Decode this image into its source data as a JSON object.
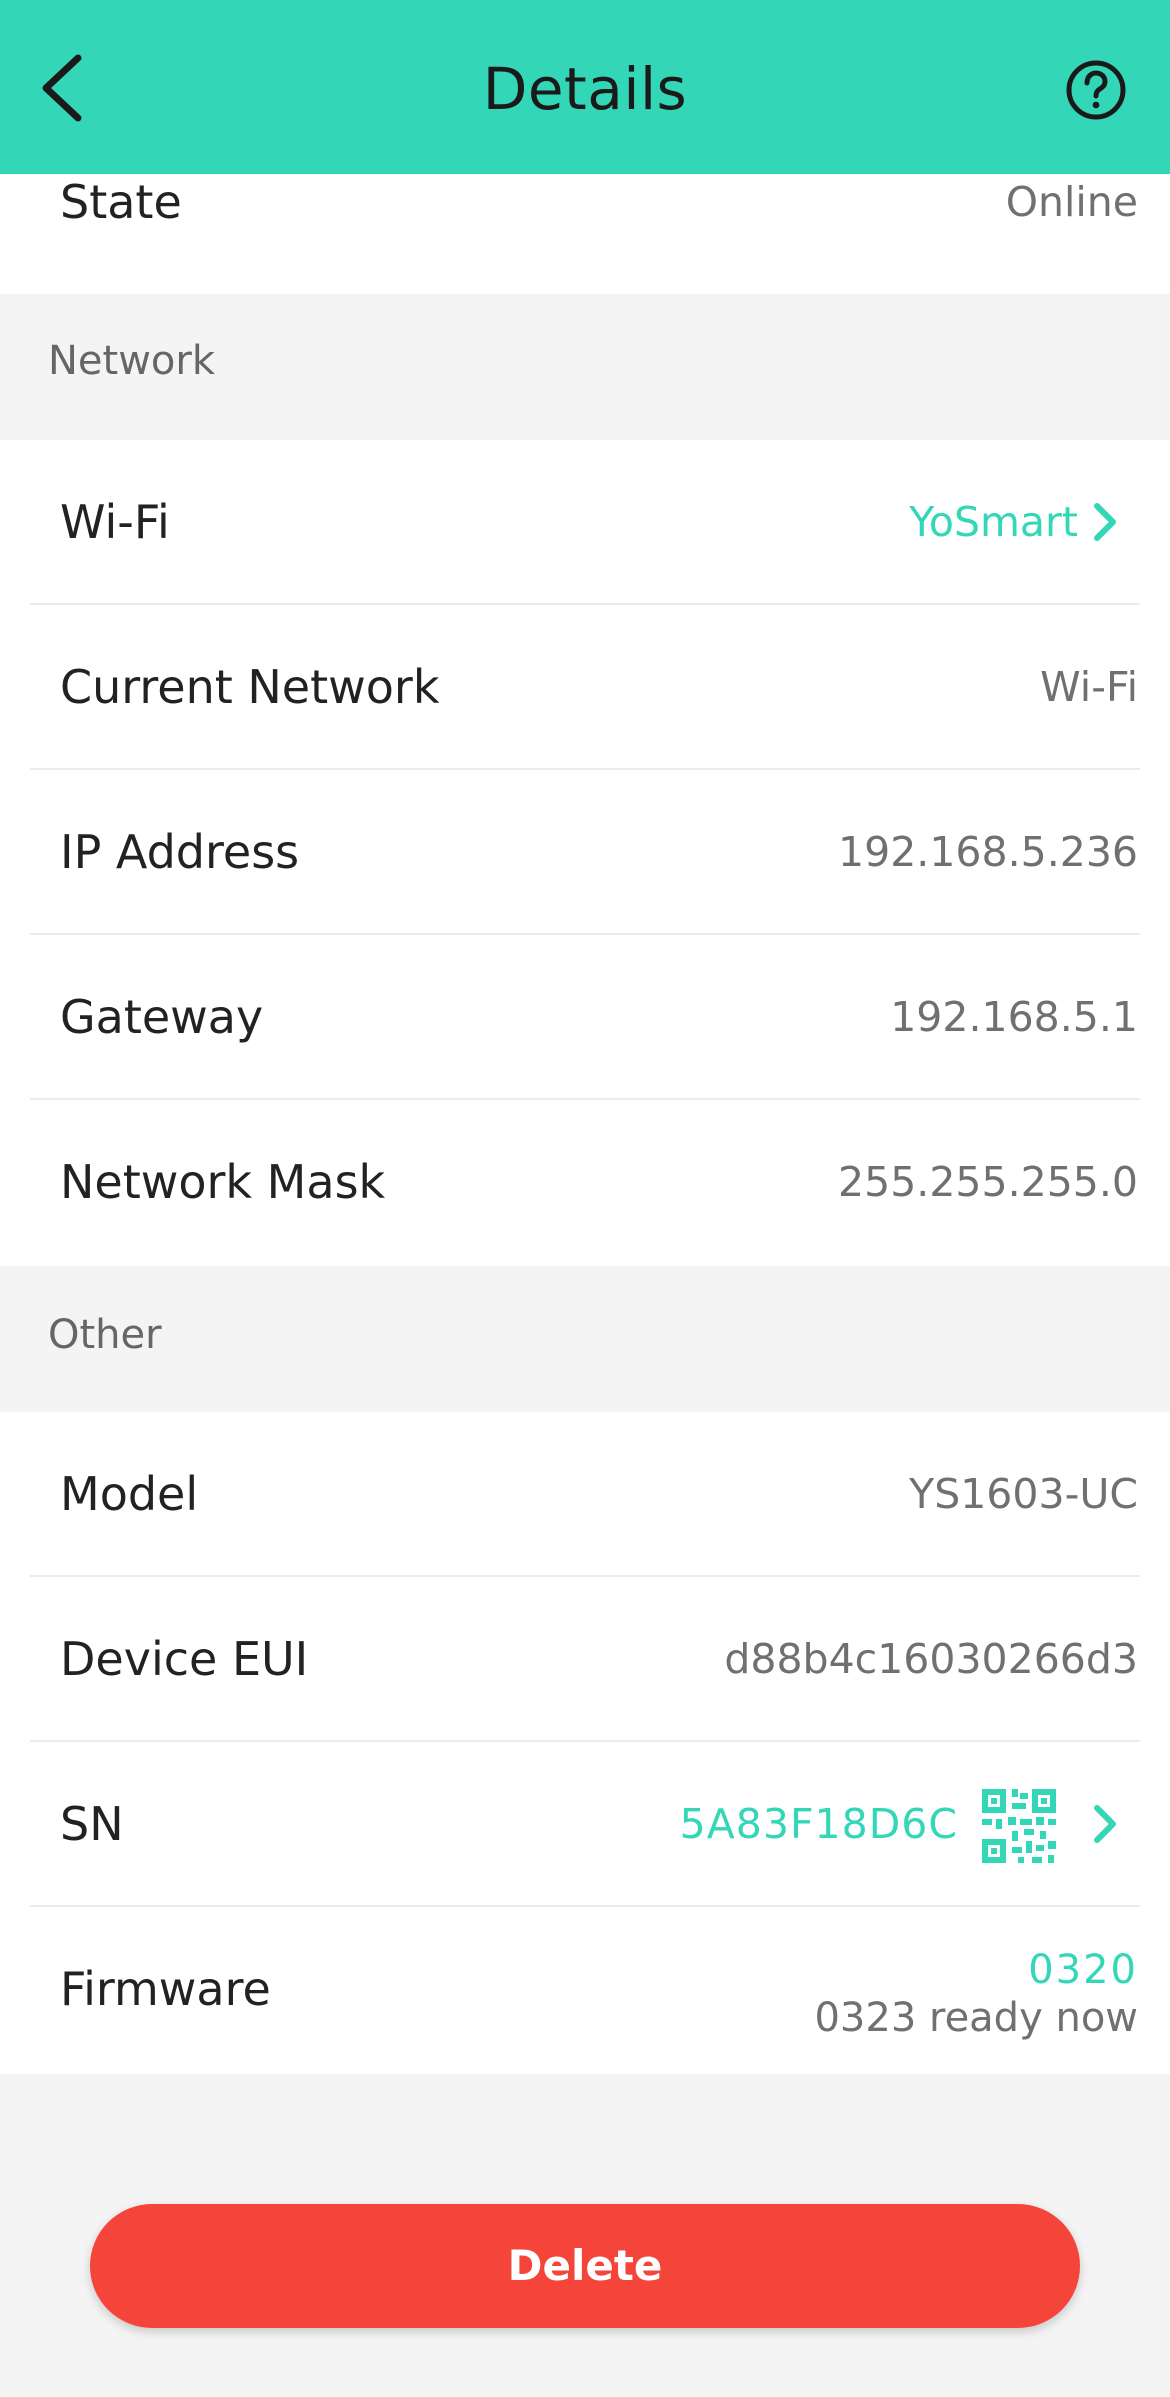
{
  "header": {
    "title": "Details",
    "back_icon": "chevron-left-icon",
    "help_icon": "question-circle-icon"
  },
  "state": {
    "label": "State",
    "value": "Online"
  },
  "network": {
    "section_title": "Network",
    "wifi": {
      "label": "Wi-Fi",
      "value": "YoSmart"
    },
    "current_network": {
      "label": "Current Network",
      "value": "Wi-Fi"
    },
    "ip_address": {
      "label": "IP Address",
      "value": "192.168.5.236"
    },
    "gateway": {
      "label": "Gateway",
      "value": "192.168.5.1"
    },
    "network_mask": {
      "label": "Network Mask",
      "value": "255.255.255.0"
    }
  },
  "other": {
    "section_title": "Other",
    "model": {
      "label": "Model",
      "value": "YS1603-UC"
    },
    "device_eui": {
      "label": "Device EUI",
      "value": "d88b4c16030266d3"
    },
    "sn": {
      "label": "SN",
      "value": "5A83F18D6C",
      "qr_icon": "qr-code-icon"
    },
    "firmware": {
      "label": "Firmware",
      "current": "0320",
      "update": "0323 ready now"
    }
  },
  "actions": {
    "delete_label": "Delete"
  },
  "colors": {
    "accent": "#33d7b7",
    "danger": "#f5443a",
    "background": "#f4f4f4"
  }
}
